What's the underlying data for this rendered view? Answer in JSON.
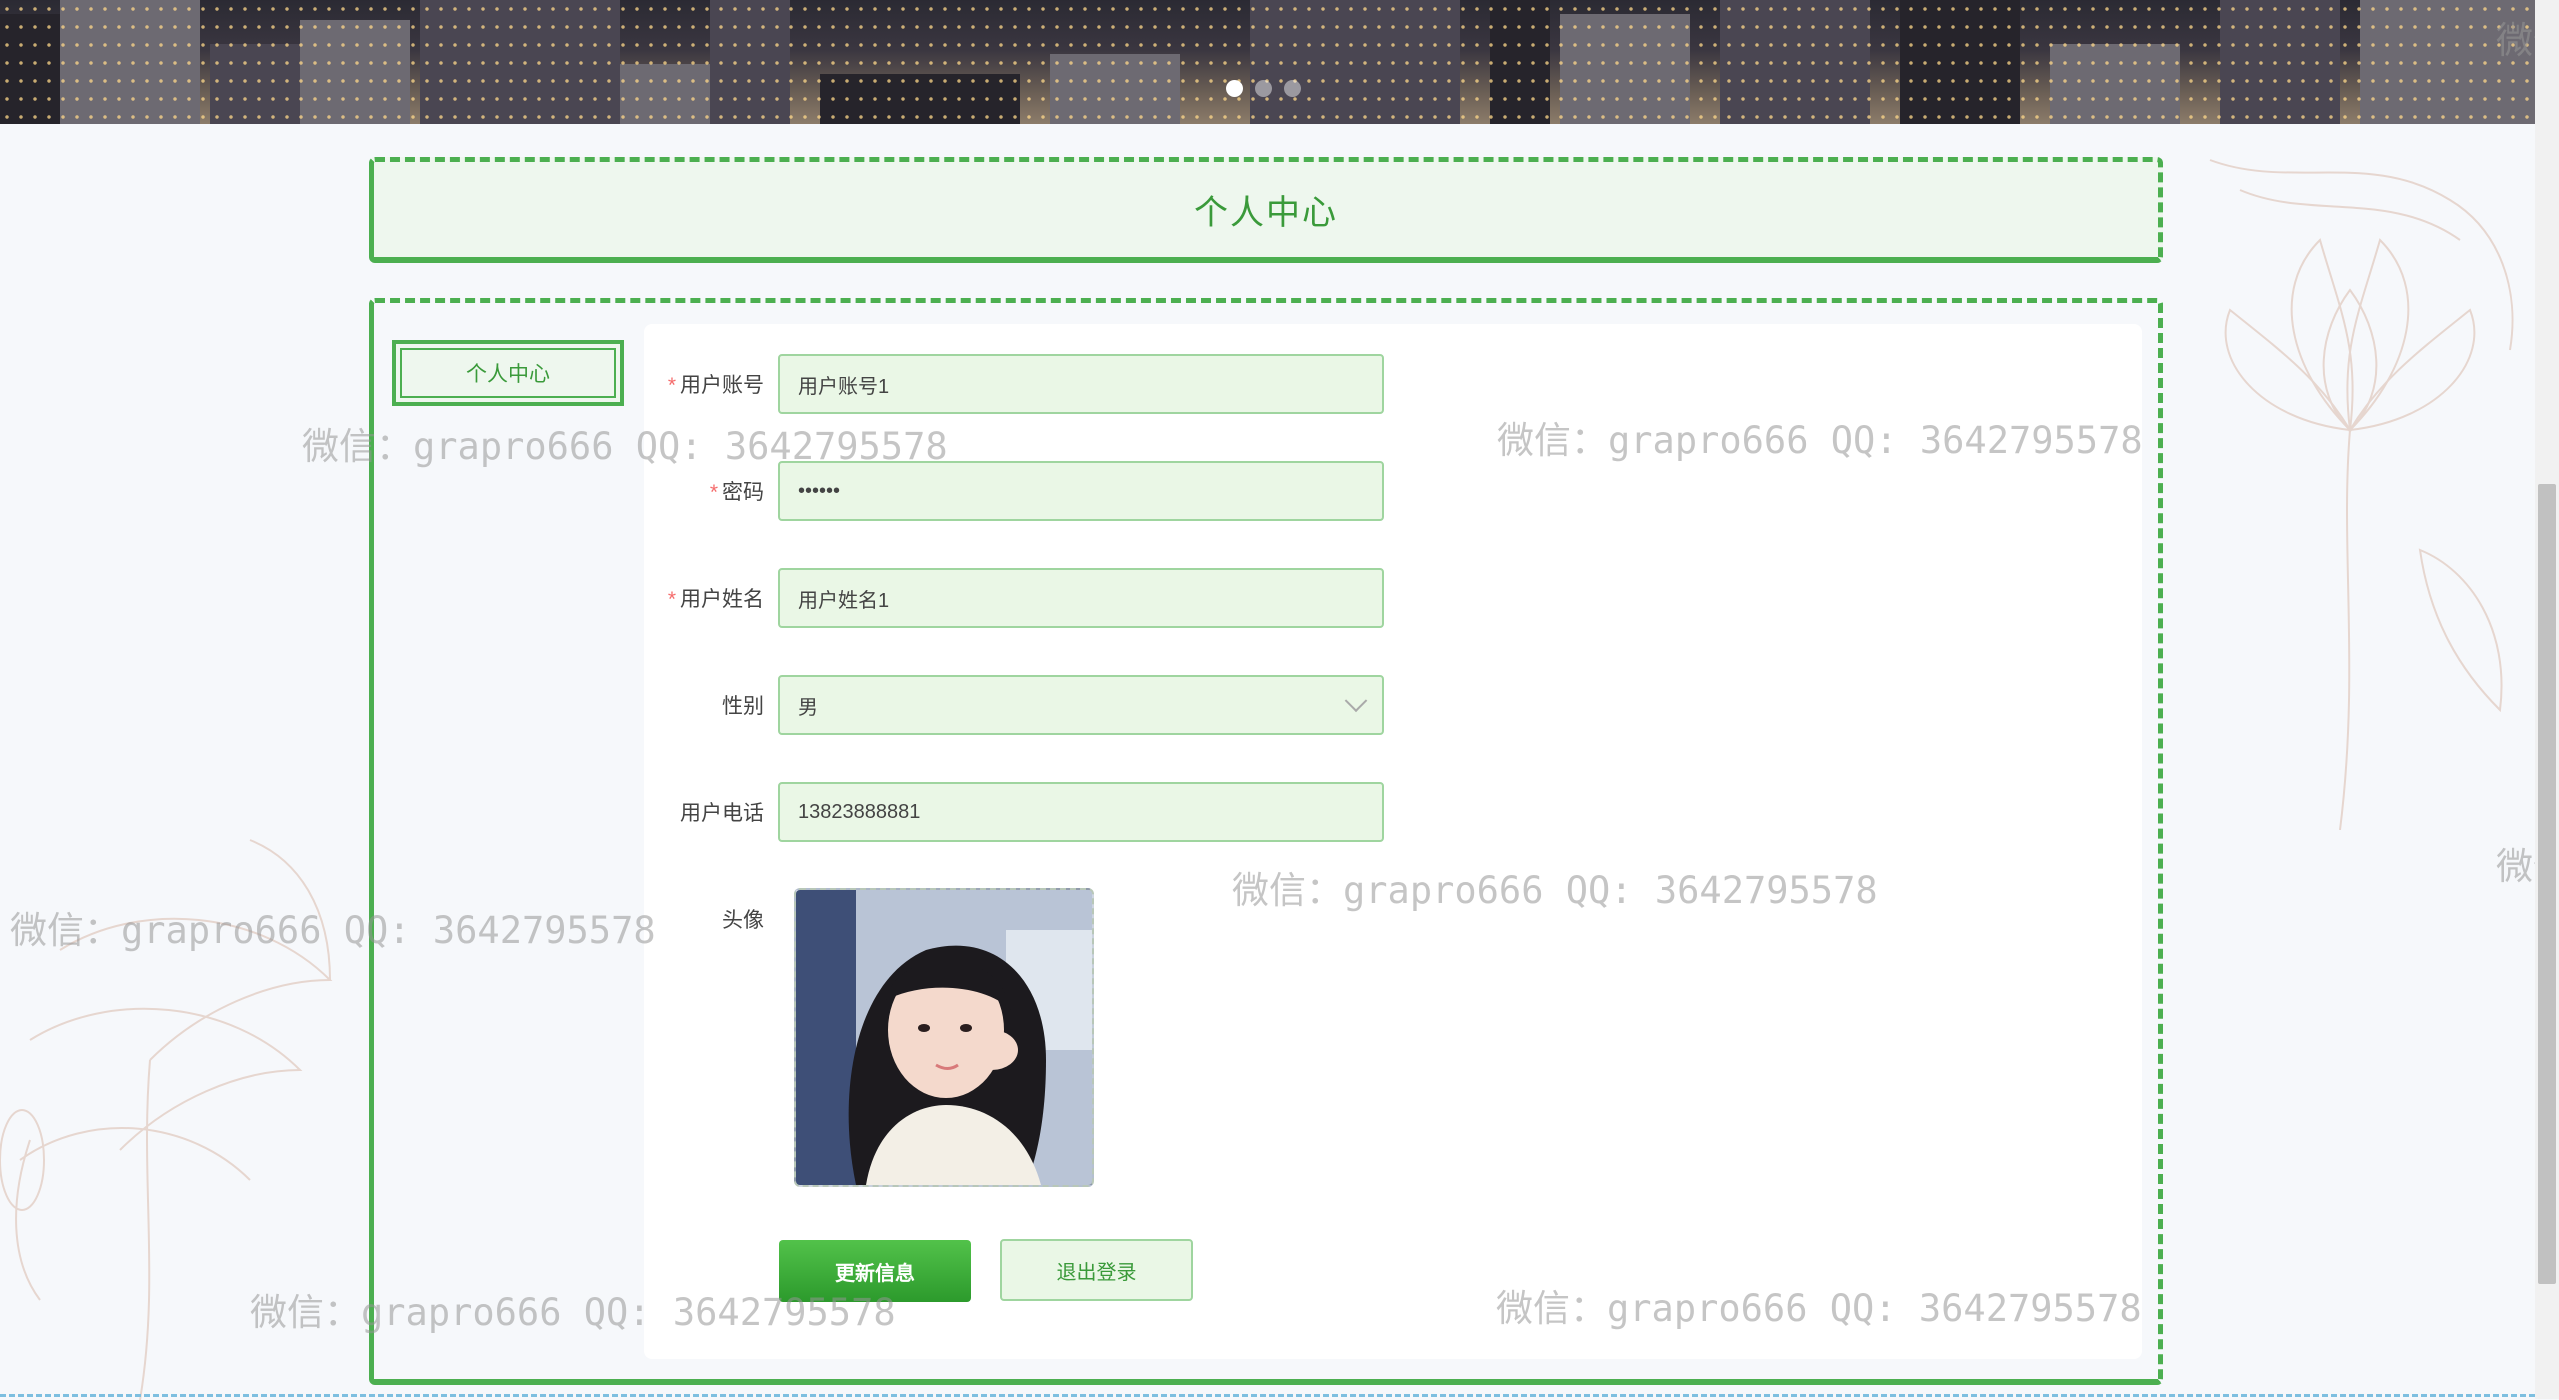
{
  "banner": {
    "slides": [
      true,
      false,
      false
    ]
  },
  "header": {
    "title": "个人中心"
  },
  "sidebar": {
    "tab_label": "个人中心"
  },
  "form": {
    "account": {
      "label": "用户账号",
      "value": "用户账号1",
      "required": "*"
    },
    "password": {
      "label": "密码",
      "value": "123456",
      "required": "*"
    },
    "name": {
      "label": "用户姓名",
      "value": "用户姓名1",
      "required": "*"
    },
    "gender": {
      "label": "性别",
      "value": "男"
    },
    "phone": {
      "label": "用户电话",
      "value": "13823888881"
    },
    "avatar": {
      "label": "头像"
    }
  },
  "buttons": {
    "update": "更新信息",
    "logout": "退出登录"
  },
  "watermark": {
    "text": "微信：grapro666 QQ: 3642795578",
    "partial": "微信"
  },
  "colors": {
    "accent": "#4caf50",
    "field_bg": "#eaf7e6",
    "required": "#f56c6c"
  }
}
